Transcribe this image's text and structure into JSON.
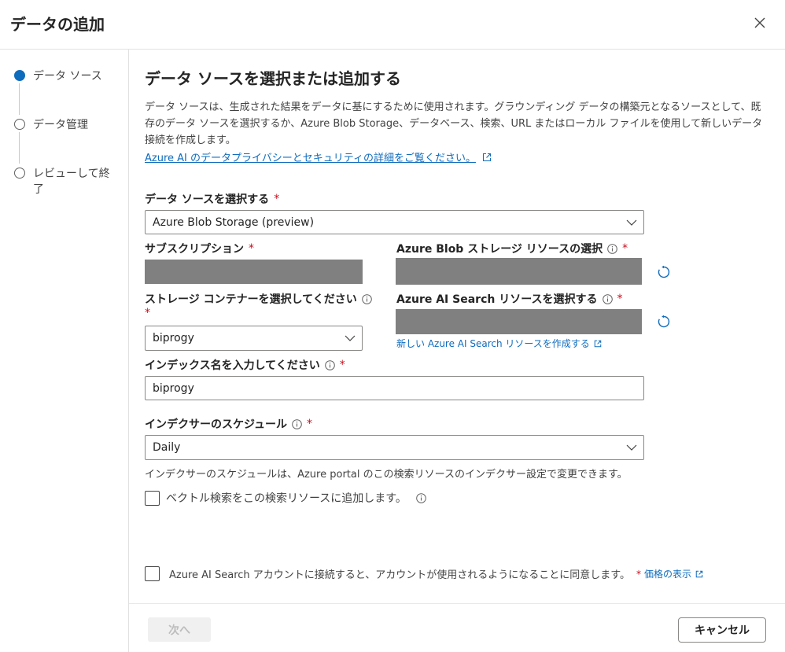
{
  "dialog": {
    "title": "データの追加",
    "close_icon": "close-icon"
  },
  "steps": [
    {
      "label": "データ ソース",
      "state": "active"
    },
    {
      "label": "データ管理",
      "state": "inactive"
    },
    {
      "label": "レビューして終了",
      "state": "inactive"
    }
  ],
  "main": {
    "title": "データ ソースを選択または追加する",
    "description": "データ ソースは、生成された結果をデータに基にするために使用されます。グラウンディング データの構築元となるソースとして、既存のデータ ソースを選択するか、Azure Blob Storage、データベース、検索、URL またはローカル ファイルを使用して新しいデータ接続を作成します。",
    "privacy_link": "Azure AI のデータプライバシーとセキュリティの詳細をご覧ください。"
  },
  "form": {
    "data_source": {
      "label": "データ ソースを選択する",
      "value": "Azure Blob Storage (preview)"
    },
    "subscription": {
      "label": "サブスクリプション"
    },
    "blob_resource": {
      "label": "Azure Blob ストレージ リソースの選択"
    },
    "container": {
      "label": "ストレージ コンテナーを選択してください",
      "value": "biprogy"
    },
    "search_resource": {
      "label": "Azure AI Search リソースを選択する",
      "create_link": "新しい Azure AI Search リソースを作成する"
    },
    "index_name": {
      "label": "インデックス名を入力してください",
      "value": "biprogy"
    },
    "schedule": {
      "label": "インデクサーのスケジュール",
      "value": "Daily",
      "helper": "インデクサーのスケジュールは、Azure portal のこの検索リソースのインデクサー設定で変更できます。"
    },
    "vector_search": {
      "label": "ベクトル検索をこの検索リソースに追加します。",
      "checked": false
    },
    "consent": {
      "label": "Azure AI Search アカウントに接続すると、アカウントが使用されるようになることに同意します。",
      "pricing_link": "価格の表示",
      "checked": false
    },
    "required_mark": "*"
  },
  "footer": {
    "next_label": "次へ",
    "cancel_label": "キャンセル"
  },
  "colors": {
    "accent": "#0f6cbd",
    "required": "#c50f1f",
    "masked": "#808080"
  }
}
